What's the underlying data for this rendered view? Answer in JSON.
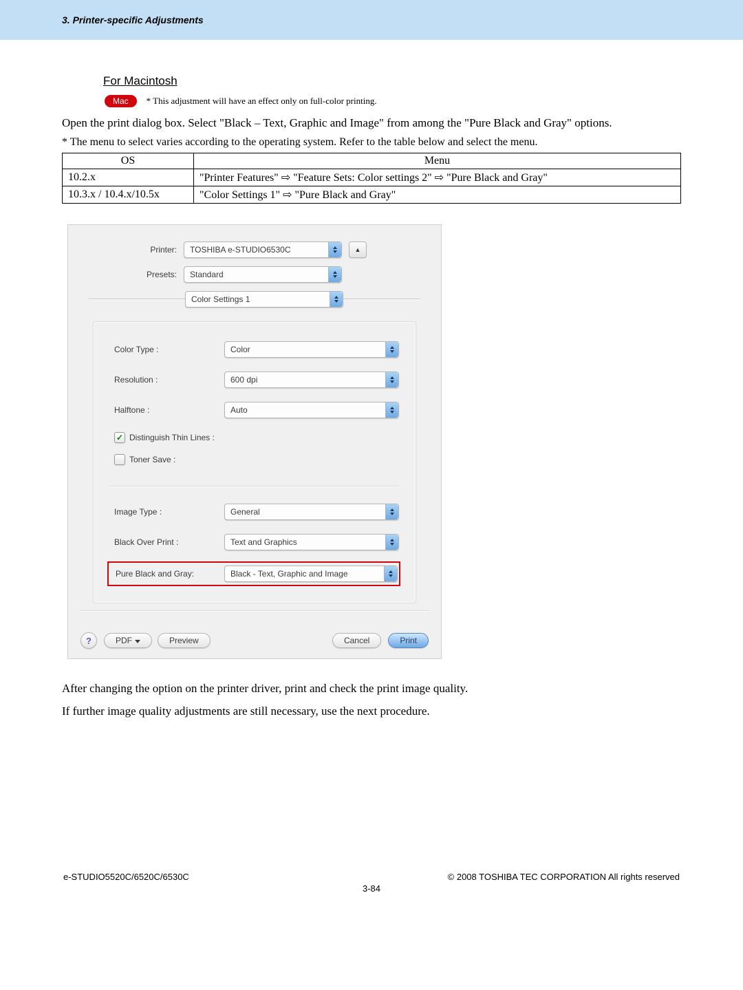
{
  "header": {
    "chapter": "3. Printer-specific Adjustments"
  },
  "section_heading": "For Macintosh",
  "mac_note": "* This adjustment will have an effect only on full-color printing.",
  "mac_badge": "Mac",
  "paragraph1": "Open the print dialog box.  Select \"Black – Text, Graphic and Image\" from among the \"Pure Black and Gray\" options.",
  "note1": "* The menu to select varies according to the operating system.  Refer to the table below and select the menu.",
  "menu_table": {
    "headers": [
      "OS",
      "Menu"
    ],
    "rows": [
      {
        "os": "10.2.x",
        "menu": "\"Printer Features\" ⇨ \"Feature Sets: Color settings 2\" ⇨ \"Pure Black and Gray\""
      },
      {
        "os": "10.3.x / 10.4.x/10.5x",
        "menu": "\"Color Settings 1\" ⇨ \"Pure Black and Gray\""
      }
    ]
  },
  "dialog": {
    "printer_label": "Printer:",
    "printer_value": "TOSHIBA e-STUDIO6530C",
    "presets_label": "Presets:",
    "presets_value": "Standard",
    "pane_value": "Color Settings 1",
    "fields": {
      "color_type_label": "Color Type :",
      "color_type_value": "Color",
      "resolution_label": "Resolution :",
      "resolution_value": "600 dpi",
      "halftone_label": "Halftone :",
      "halftone_value": "Auto",
      "distinguish_label": "Distinguish Thin Lines :",
      "distinguish_checked": true,
      "toner_label": "Toner Save :",
      "toner_checked": false,
      "image_type_label": "Image Type :",
      "image_type_value": "General",
      "black_over_label": "Black Over Print :",
      "black_over_value": "Text and Graphics",
      "pure_black_label": "Pure Black and Gray:",
      "pure_black_value": "Black - Text, Graphic and Image"
    },
    "buttons": {
      "help": "?",
      "pdf": "PDF",
      "preview": "Preview",
      "cancel": "Cancel",
      "print": "Print"
    },
    "lock_icon": "▲"
  },
  "paragraph2": "After changing the option on the printer driver, print and check the print image quality.",
  "paragraph3": "If further image quality adjustments are still necessary, use the next procedure.",
  "footer": {
    "left": "e-STUDIO5520C/6520C/6530C",
    "right": "© 2008 TOSHIBA TEC CORPORATION All rights reserved",
    "page": "3-84"
  }
}
